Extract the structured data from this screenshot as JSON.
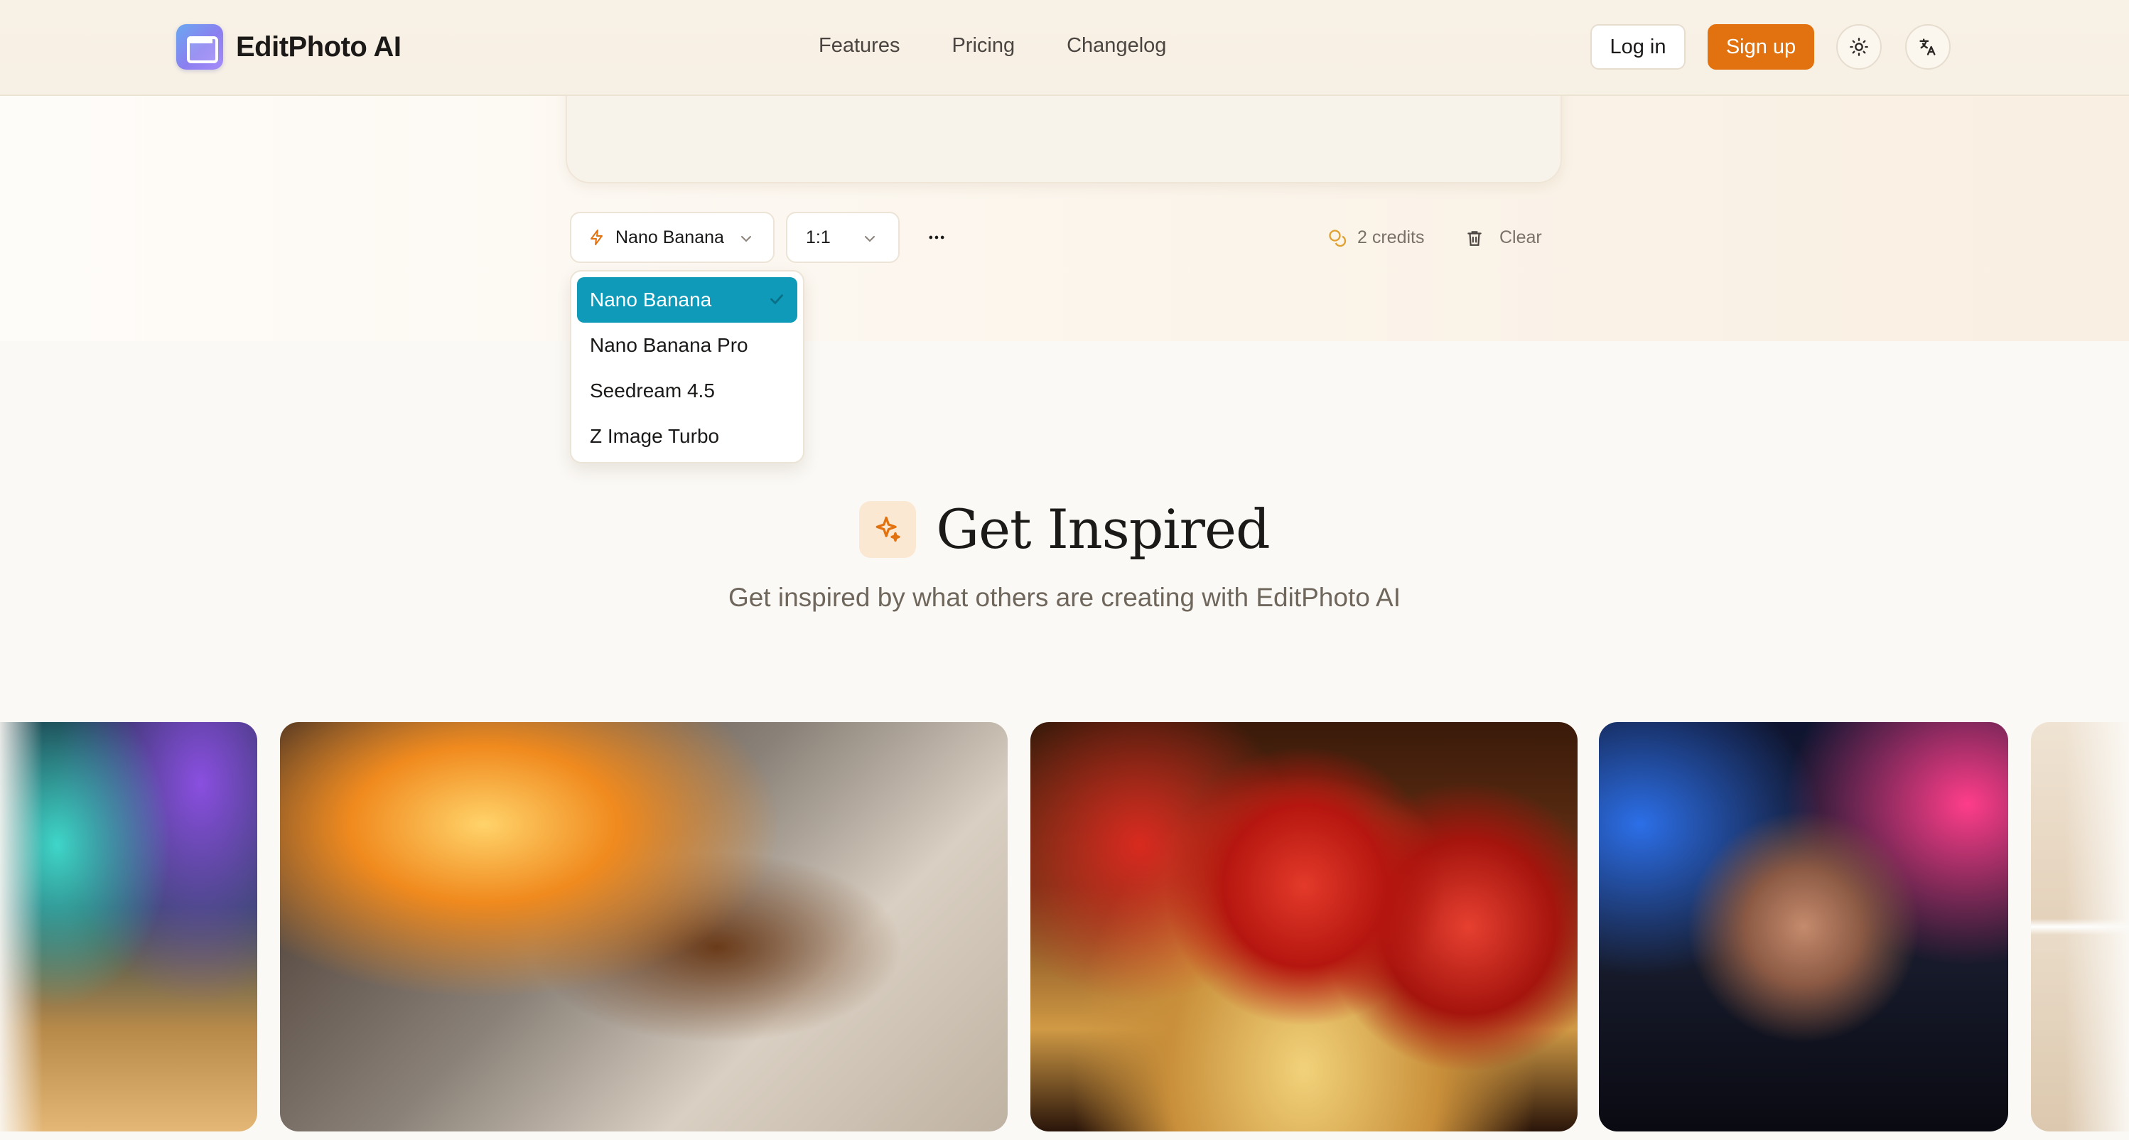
{
  "header": {
    "brand": "EditPhoto AI",
    "nav": [
      "Features",
      "Pricing",
      "Changelog"
    ],
    "login": "Log in",
    "signup": "Sign up",
    "theme_icon": "sun-icon",
    "language_icon": "translate-icon",
    "accent_color": "#e27210"
  },
  "toolbar": {
    "model": "Nano Banana",
    "aspect_ratio": "1:1",
    "more_icon": "more-horizontal-icon",
    "credits": "2 credits",
    "clear": "Clear"
  },
  "model_dropdown": {
    "options": [
      "Nano Banana",
      "Nano Banana Pro",
      "Seedream 4.5",
      "Z Image Turbo"
    ],
    "selected": "Nano Banana",
    "selected_color": "#0e9ab8"
  },
  "section": {
    "title": "Get Inspired",
    "subtitle": "Get inspired by what others are creating with EditPhoto AI",
    "icon": "sparkles-icon"
  },
  "gallery": {
    "items": [
      "fantasy-battle-image",
      "anime-runner-fire-image",
      "strawberry-tart-image",
      "neon-portrait-image",
      "interior-room-image"
    ]
  }
}
